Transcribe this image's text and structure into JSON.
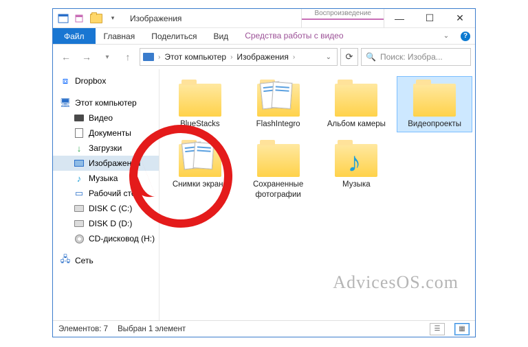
{
  "titlebar": {
    "title": "Изображения",
    "context_tab": "Воспроизведение",
    "min_glyph": "—",
    "max_glyph": "☐",
    "close_glyph": "✕",
    "qat_chevron": "▾"
  },
  "ribbon": {
    "file": "Файл",
    "tabs": [
      "Главная",
      "Поделиться",
      "Вид"
    ],
    "context_tab": "Средства работы с видео",
    "toggle_glyph": "⌄",
    "help_glyph": "?"
  },
  "address": {
    "back_glyph": "←",
    "forward_glyph": "→",
    "recent_glyph": "▾",
    "up_glyph": "↑",
    "segments": [
      "Этот компьютер",
      "Изображения"
    ],
    "seg_sep": "›",
    "drop_glyph": "⌄",
    "refresh_glyph": "⟳"
  },
  "search": {
    "icon": "🔍",
    "placeholder": "Поиск: Изобра..."
  },
  "sidebar": {
    "items": [
      {
        "label": "Dropbox",
        "icon": "dropbox"
      },
      {
        "label": "Этот компьютер",
        "icon": "pc"
      },
      {
        "label": "Видео",
        "icon": "vid",
        "child": true
      },
      {
        "label": "Документы",
        "icon": "doc",
        "child": true
      },
      {
        "label": "Загрузки",
        "icon": "dl",
        "child": true
      },
      {
        "label": "Изображения",
        "icon": "pic",
        "child": true,
        "selected": true
      },
      {
        "label": "Музыка",
        "icon": "music",
        "child": true
      },
      {
        "label": "Рабочий стол",
        "icon": "desk",
        "child": true
      },
      {
        "label": "DISK C (C:)",
        "icon": "disk",
        "child": true
      },
      {
        "label": "DISK D (D:)",
        "icon": "disk",
        "child": true
      },
      {
        "label": "CD-дисковод (H:)",
        "icon": "cd",
        "child": true
      },
      {
        "label": "Сеть",
        "icon": "net"
      }
    ]
  },
  "folders": [
    {
      "label": "BlueStacks",
      "thumbs": false
    },
    {
      "label": "FlashIntegro",
      "thumbs": "lines"
    },
    {
      "label": "Альбом камеры",
      "thumbs": false
    },
    {
      "label": "Видеопроекты",
      "thumbs": false,
      "selected": true
    },
    {
      "label": "Снимки экрана",
      "thumbs": "screens"
    },
    {
      "label": "Сохраненные фотографии",
      "thumbs": false
    },
    {
      "label": "Музыка",
      "thumbs": "music"
    }
  ],
  "status": {
    "count": "Элементов: 7",
    "selection": "Выбран 1 элемент"
  },
  "watermark": "AdvicesOS.com"
}
